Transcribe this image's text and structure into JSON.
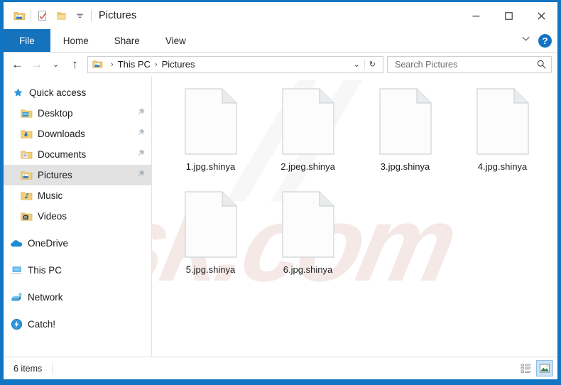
{
  "window": {
    "title": "Pictures",
    "accent_color": "#1075c2",
    "controls": {
      "minimize": "—",
      "maximize": "☐",
      "close": "✕"
    }
  },
  "quick_access_toolbar": {
    "items": [
      {
        "name": "pictures-folder-icon",
        "tooltip": "Pictures"
      },
      {
        "name": "properties-icon",
        "tooltip": "Properties"
      },
      {
        "name": "new-folder-icon",
        "tooltip": "New folder"
      },
      {
        "name": "customize-dropdown-icon",
        "tooltip": "Customize Quick Access Toolbar"
      }
    ]
  },
  "ribbon": {
    "tabs": [
      {
        "label": "File",
        "active": true
      },
      {
        "label": "Home",
        "active": false
      },
      {
        "label": "Share",
        "active": false
      },
      {
        "label": "View",
        "active": false
      }
    ],
    "expand_icon": "chevron-down-icon",
    "help_label": "?"
  },
  "addressbar": {
    "back_arrow": "←",
    "forward_arrow": "→",
    "recent_chevron": "⌄",
    "up_arrow": "↑",
    "breadcrumb": [
      "This PC",
      "Pictures"
    ],
    "separator": "›",
    "dropdown_chevron": "⌄",
    "refresh_icon": "↻"
  },
  "search": {
    "placeholder": "Search Pictures",
    "value": "",
    "icon": "search-icon"
  },
  "sidebar": {
    "items": [
      {
        "label": "Quick access",
        "icon": "star-icon",
        "level": "root",
        "pinned": false,
        "selected": false
      },
      {
        "label": "Desktop",
        "icon": "desktop-folder-icon",
        "level": "child",
        "pinned": true,
        "selected": false
      },
      {
        "label": "Downloads",
        "icon": "downloads-folder-icon",
        "level": "child",
        "pinned": true,
        "selected": false
      },
      {
        "label": "Documents",
        "icon": "documents-folder-icon",
        "level": "child",
        "pinned": true,
        "selected": false
      },
      {
        "label": "Pictures",
        "icon": "pictures-folder-icon",
        "level": "child",
        "pinned": true,
        "selected": true
      },
      {
        "label": "Music",
        "icon": "music-folder-icon",
        "level": "child",
        "pinned": false,
        "selected": false
      },
      {
        "label": "Videos",
        "icon": "videos-folder-icon",
        "level": "child",
        "pinned": false,
        "selected": false
      },
      {
        "label": "OneDrive",
        "icon": "onedrive-cloud-icon",
        "level": "group",
        "pinned": false,
        "selected": false
      },
      {
        "label": "This PC",
        "icon": "this-pc-icon",
        "level": "group",
        "pinned": false,
        "selected": false
      },
      {
        "label": "Network",
        "icon": "network-icon",
        "level": "group",
        "pinned": false,
        "selected": false
      },
      {
        "label": "Catch!",
        "icon": "catch-lightning-icon",
        "level": "group",
        "pinned": false,
        "selected": false
      }
    ]
  },
  "files": [
    {
      "name": "1.jpg.shinya",
      "icon": "blank-document-icon"
    },
    {
      "name": "2.jpeg.shinya",
      "icon": "blank-document-icon"
    },
    {
      "name": "3.jpg.shinya",
      "icon": "blank-document-icon"
    },
    {
      "name": "4.jpg.shinya",
      "icon": "blank-document-icon"
    },
    {
      "name": "5.jpg.shinya",
      "icon": "blank-document-icon"
    },
    {
      "name": "6.jpg.shinya",
      "icon": "blank-document-icon"
    }
  ],
  "watermark": {
    "text": "sk.com"
  },
  "statusbar": {
    "item_count": "6 items",
    "views": [
      {
        "name": "details-view-button",
        "active": false
      },
      {
        "name": "large-icons-view-button",
        "active": true
      }
    ]
  }
}
